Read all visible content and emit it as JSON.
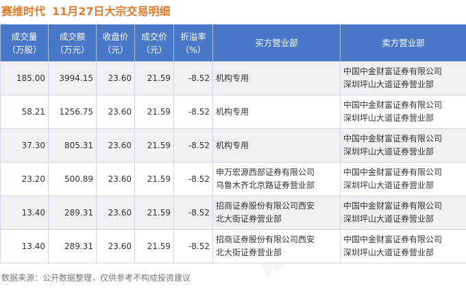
{
  "title": {
    "stock": "赛维时代",
    "date_label": "11月27日大宗交易明细"
  },
  "table": {
    "headers": [
      "成交量\n（万股）",
      "成交额\n（万元）",
      "收盘价\n（元）",
      "成交价\n（元）",
      "折溢率\n（%）",
      "买方营业部",
      "卖方营业部"
    ],
    "rows": [
      [
        "185.00",
        "3994.15",
        "23.60",
        "21.59",
        "-8.52",
        "机构专用",
        "中国中金财富证券有限公司\n深圳坪山大道证券营业部"
      ],
      [
        "58.21",
        "1256.75",
        "23.60",
        "21.59",
        "-8.52",
        "机构专用",
        "中国中金财富证券有限公司\n深圳坪山大道证券营业部"
      ],
      [
        "37.30",
        "805.31",
        "23.60",
        "21.59",
        "-8.52",
        "机构专用",
        "中国中金财富证券有限公司\n深圳坪山大道证券营业部"
      ],
      [
        "23.20",
        "500.89",
        "23.60",
        "21.59",
        "-8.52",
        "申万宏源西部证券有限公司\n乌鲁木齐北京路证券营业部",
        "中国中金财富证券有限公司\n深圳坪山大道证券营业部"
      ],
      [
        "13.40",
        "289.31",
        "23.60",
        "21.59",
        "-8.52",
        "招商证券股份有限公司西安\n北大街证券营业部",
        "中国中金财富证券有限公司\n深圳坪山大道证券营业部"
      ],
      [
        "13.40",
        "289.31",
        "23.60",
        "21.59",
        "-8.52",
        "招商证券股份有限公司西安\n北大街证券营业部",
        "中国中金财富证券有限公司\n深圳坪山大道证券营业部"
      ]
    ]
  },
  "footer": "数据来源：公开数据整理，仅供参考不构成投资建议",
  "colors": {
    "title": "#e07a2b",
    "header_bg": "#4a78c8",
    "negative": "#2e8b3d",
    "row_shade": "#f0f0f2"
  }
}
